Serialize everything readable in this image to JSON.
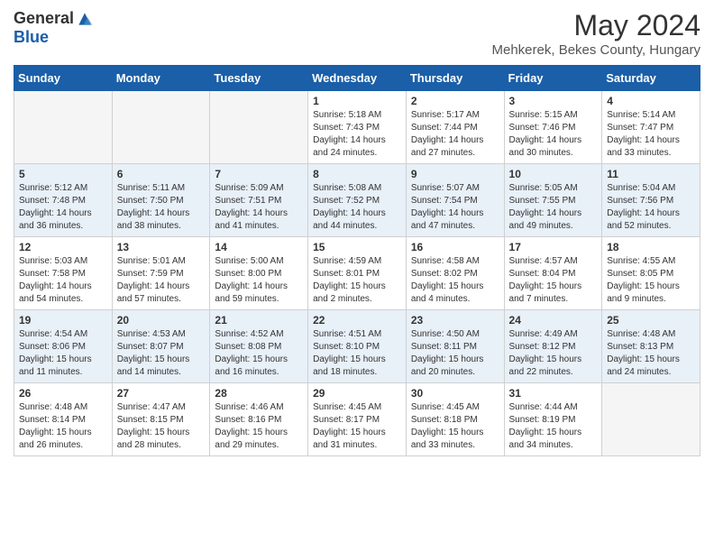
{
  "logo": {
    "general": "General",
    "blue": "Blue"
  },
  "title": "May 2024",
  "subtitle": "Mehkerek, Bekes County, Hungary",
  "days_of_week": [
    "Sunday",
    "Monday",
    "Tuesday",
    "Wednesday",
    "Thursday",
    "Friday",
    "Saturday"
  ],
  "weeks": [
    [
      {
        "day": "",
        "sunrise": "",
        "sunset": "",
        "daylight": ""
      },
      {
        "day": "",
        "sunrise": "",
        "sunset": "",
        "daylight": ""
      },
      {
        "day": "",
        "sunrise": "",
        "sunset": "",
        "daylight": ""
      },
      {
        "day": "1",
        "sunrise": "Sunrise: 5:18 AM",
        "sunset": "Sunset: 7:43 PM",
        "daylight": "Daylight: 14 hours and 24 minutes."
      },
      {
        "day": "2",
        "sunrise": "Sunrise: 5:17 AM",
        "sunset": "Sunset: 7:44 PM",
        "daylight": "Daylight: 14 hours and 27 minutes."
      },
      {
        "day": "3",
        "sunrise": "Sunrise: 5:15 AM",
        "sunset": "Sunset: 7:46 PM",
        "daylight": "Daylight: 14 hours and 30 minutes."
      },
      {
        "day": "4",
        "sunrise": "Sunrise: 5:14 AM",
        "sunset": "Sunset: 7:47 PM",
        "daylight": "Daylight: 14 hours and 33 minutes."
      }
    ],
    [
      {
        "day": "5",
        "sunrise": "Sunrise: 5:12 AM",
        "sunset": "Sunset: 7:48 PM",
        "daylight": "Daylight: 14 hours and 36 minutes."
      },
      {
        "day": "6",
        "sunrise": "Sunrise: 5:11 AM",
        "sunset": "Sunset: 7:50 PM",
        "daylight": "Daylight: 14 hours and 38 minutes."
      },
      {
        "day": "7",
        "sunrise": "Sunrise: 5:09 AM",
        "sunset": "Sunset: 7:51 PM",
        "daylight": "Daylight: 14 hours and 41 minutes."
      },
      {
        "day": "8",
        "sunrise": "Sunrise: 5:08 AM",
        "sunset": "Sunset: 7:52 PM",
        "daylight": "Daylight: 14 hours and 44 minutes."
      },
      {
        "day": "9",
        "sunrise": "Sunrise: 5:07 AM",
        "sunset": "Sunset: 7:54 PM",
        "daylight": "Daylight: 14 hours and 47 minutes."
      },
      {
        "day": "10",
        "sunrise": "Sunrise: 5:05 AM",
        "sunset": "Sunset: 7:55 PM",
        "daylight": "Daylight: 14 hours and 49 minutes."
      },
      {
        "day": "11",
        "sunrise": "Sunrise: 5:04 AM",
        "sunset": "Sunset: 7:56 PM",
        "daylight": "Daylight: 14 hours and 52 minutes."
      }
    ],
    [
      {
        "day": "12",
        "sunrise": "Sunrise: 5:03 AM",
        "sunset": "Sunset: 7:58 PM",
        "daylight": "Daylight: 14 hours and 54 minutes."
      },
      {
        "day": "13",
        "sunrise": "Sunrise: 5:01 AM",
        "sunset": "Sunset: 7:59 PM",
        "daylight": "Daylight: 14 hours and 57 minutes."
      },
      {
        "day": "14",
        "sunrise": "Sunrise: 5:00 AM",
        "sunset": "Sunset: 8:00 PM",
        "daylight": "Daylight: 14 hours and 59 minutes."
      },
      {
        "day": "15",
        "sunrise": "Sunrise: 4:59 AM",
        "sunset": "Sunset: 8:01 PM",
        "daylight": "Daylight: 15 hours and 2 minutes."
      },
      {
        "day": "16",
        "sunrise": "Sunrise: 4:58 AM",
        "sunset": "Sunset: 8:02 PM",
        "daylight": "Daylight: 15 hours and 4 minutes."
      },
      {
        "day": "17",
        "sunrise": "Sunrise: 4:57 AM",
        "sunset": "Sunset: 8:04 PM",
        "daylight": "Daylight: 15 hours and 7 minutes."
      },
      {
        "day": "18",
        "sunrise": "Sunrise: 4:55 AM",
        "sunset": "Sunset: 8:05 PM",
        "daylight": "Daylight: 15 hours and 9 minutes."
      }
    ],
    [
      {
        "day": "19",
        "sunrise": "Sunrise: 4:54 AM",
        "sunset": "Sunset: 8:06 PM",
        "daylight": "Daylight: 15 hours and 11 minutes."
      },
      {
        "day": "20",
        "sunrise": "Sunrise: 4:53 AM",
        "sunset": "Sunset: 8:07 PM",
        "daylight": "Daylight: 15 hours and 14 minutes."
      },
      {
        "day": "21",
        "sunrise": "Sunrise: 4:52 AM",
        "sunset": "Sunset: 8:08 PM",
        "daylight": "Daylight: 15 hours and 16 minutes."
      },
      {
        "day": "22",
        "sunrise": "Sunrise: 4:51 AM",
        "sunset": "Sunset: 8:10 PM",
        "daylight": "Daylight: 15 hours and 18 minutes."
      },
      {
        "day": "23",
        "sunrise": "Sunrise: 4:50 AM",
        "sunset": "Sunset: 8:11 PM",
        "daylight": "Daylight: 15 hours and 20 minutes."
      },
      {
        "day": "24",
        "sunrise": "Sunrise: 4:49 AM",
        "sunset": "Sunset: 8:12 PM",
        "daylight": "Daylight: 15 hours and 22 minutes."
      },
      {
        "day": "25",
        "sunrise": "Sunrise: 4:48 AM",
        "sunset": "Sunset: 8:13 PM",
        "daylight": "Daylight: 15 hours and 24 minutes."
      }
    ],
    [
      {
        "day": "26",
        "sunrise": "Sunrise: 4:48 AM",
        "sunset": "Sunset: 8:14 PM",
        "daylight": "Daylight: 15 hours and 26 minutes."
      },
      {
        "day": "27",
        "sunrise": "Sunrise: 4:47 AM",
        "sunset": "Sunset: 8:15 PM",
        "daylight": "Daylight: 15 hours and 28 minutes."
      },
      {
        "day": "28",
        "sunrise": "Sunrise: 4:46 AM",
        "sunset": "Sunset: 8:16 PM",
        "daylight": "Daylight: 15 hours and 29 minutes."
      },
      {
        "day": "29",
        "sunrise": "Sunrise: 4:45 AM",
        "sunset": "Sunset: 8:17 PM",
        "daylight": "Daylight: 15 hours and 31 minutes."
      },
      {
        "day": "30",
        "sunrise": "Sunrise: 4:45 AM",
        "sunset": "Sunset: 8:18 PM",
        "daylight": "Daylight: 15 hours and 33 minutes."
      },
      {
        "day": "31",
        "sunrise": "Sunrise: 4:44 AM",
        "sunset": "Sunset: 8:19 PM",
        "daylight": "Daylight: 15 hours and 34 minutes."
      },
      {
        "day": "",
        "sunrise": "",
        "sunset": "",
        "daylight": ""
      }
    ]
  ]
}
